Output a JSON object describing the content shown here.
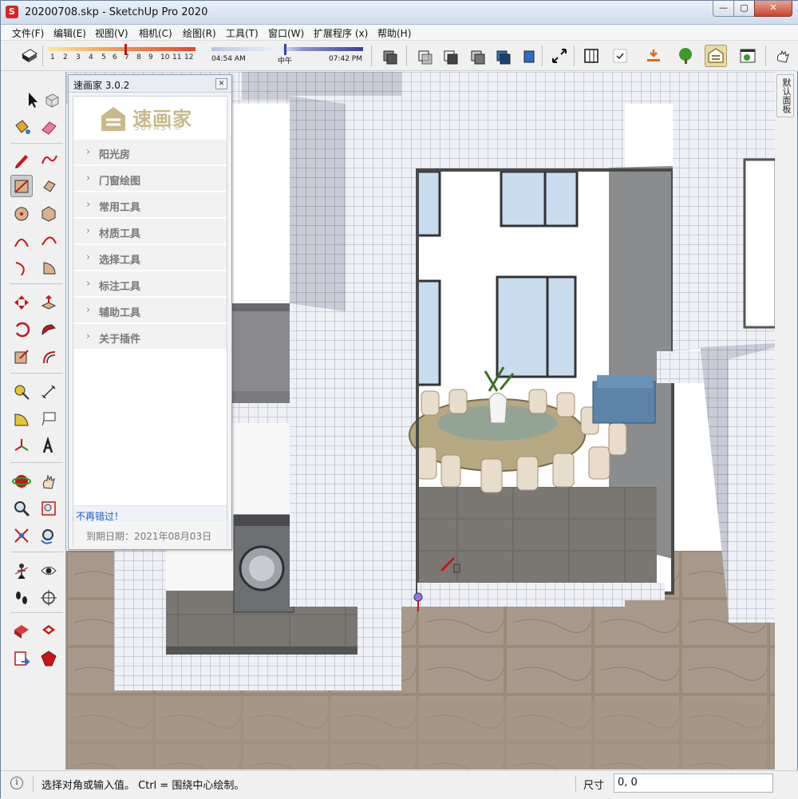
{
  "window": {
    "title": "20200708.skp - SketchUp Pro 2020",
    "controls": {
      "minimize": "—",
      "maximize": "▢",
      "close": "✕"
    }
  },
  "menu": [
    "文件(F)",
    "编辑(E)",
    "视图(V)",
    "相机(C)",
    "绘图(R)",
    "工具(T)",
    "窗口(W)",
    "扩展程序 (x)",
    "帮助(H)"
  ],
  "shadows": {
    "months": [
      "1",
      "2",
      "3",
      "4",
      "5",
      "6",
      "7",
      "8",
      "9",
      "10",
      "11",
      "12"
    ],
    "time_start": "04:54 AM",
    "time_mid": "中午",
    "time_end": "07:42 PM"
  },
  "tray_tab": "默认面板",
  "plugin": {
    "title": "速画家 3.0.2",
    "close": "✕",
    "logo_cn": "速画家",
    "logo_en": "SUFAST®",
    "items": [
      "阳光房",
      "门窗绘图",
      "常用工具",
      "材质工具",
      "选择工具",
      "标注工具",
      "辅助工具",
      "关于插件"
    ],
    "chevron": "›",
    "tagline": "不再错过！",
    "expiry": "到期日期：2021年08月03日"
  },
  "status": {
    "info_icon": "i",
    "text": "选择对角或输入值。 Ctrl = 围绕中心绘制。",
    "measure_label": "尺寸",
    "measure_value": "0, 0"
  },
  "colors": {
    "accent_red": "#c4161c",
    "logo_gold": "#c8b98a",
    "tagline_blue": "#1f5fbf"
  }
}
